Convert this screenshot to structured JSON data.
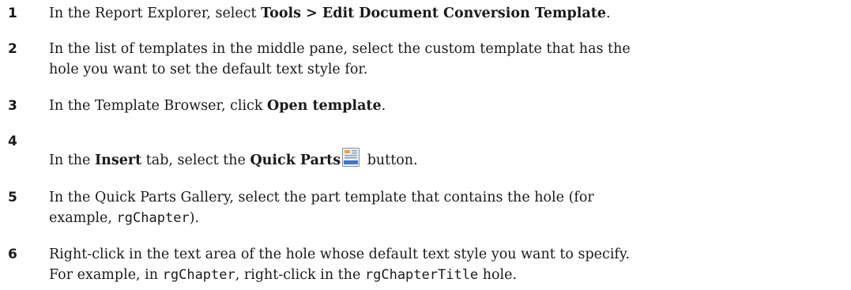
{
  "steps": [
    {
      "number": "1",
      "t1": "In the Report Explorer, select ",
      "b1": "Tools > Edit Document Conversion Template",
      "t2": "."
    },
    {
      "number": "2",
      "line1": "In the list of templates in the middle pane, select the custom template that has the",
      "line2": "hole you want to set the default text style for."
    },
    {
      "number": "3",
      "t1": "In the Template Browser, click ",
      "b1": "Open template",
      "t2": "."
    },
    {
      "number": "4",
      "t1": "In the ",
      "b1": "Insert",
      "t2": " tab, select the ",
      "b2": "Quick Parts",
      "icon": "quick-parts-icon",
      "t3": " button."
    },
    {
      "number": "5",
      "line1": "In the Quick Parts Gallery, select the part template that contains the hole (for",
      "l2a": "example, ",
      "l2code": "rgChapter",
      "l2b": ")."
    },
    {
      "number": "6",
      "line1": "Right-click in the text area of the hole whose default text style you want to specify.",
      "l2a": "For example, in ",
      "l2code1": "rgChapter",
      "l2b": ", right-click in the ",
      "l2code2": "rgChapterTitle",
      "l2c": " hole."
    }
  ]
}
